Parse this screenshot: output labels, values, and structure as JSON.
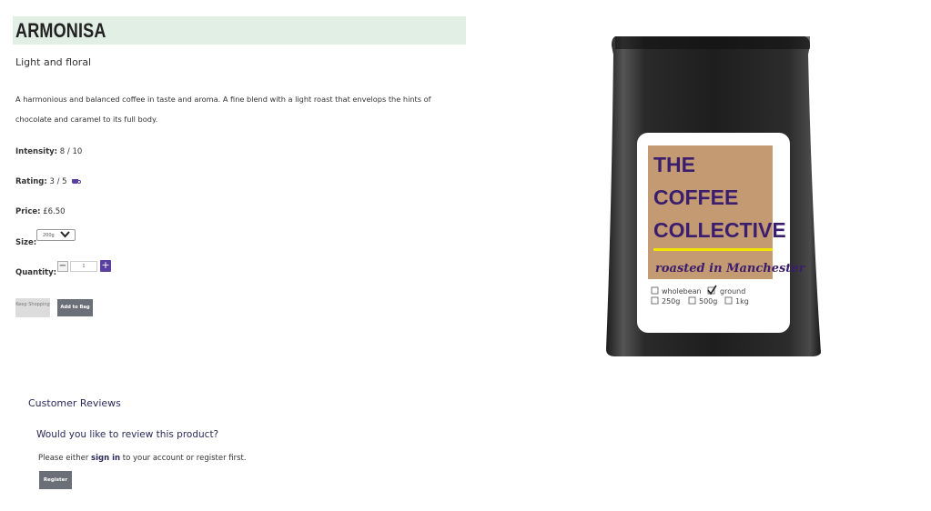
{
  "product": {
    "name": "ARMONISA",
    "subtitle": "Light and floral",
    "description": "A harmonious and balanced coffee in taste and aroma. A fine blend with a light roast that envelops the hints of chocolate and caramel to its full body.",
    "intensity_label": "Intensity:",
    "intensity_value": "8 / 10",
    "rating_label": "Rating:",
    "rating_value": "3 / 5",
    "price_label": "Price:",
    "price_value": "£6.50",
    "size_label": "Size:",
    "size_selected": "200g",
    "quantity_label": "Quantity:",
    "quantity_value": "1"
  },
  "buttons": {
    "keep_shopping": "Keep Shopping",
    "add_to_bag": "Add to Bag",
    "register": "Register",
    "minus": "−",
    "plus": "+"
  },
  "reviews": {
    "title": "Customer Reviews",
    "question": "Would you like to review this product?",
    "prompt_before": "Please either ",
    "sign_in_link": "sign in",
    "prompt_after": " to your account or register first."
  },
  "bag_label": {
    "line1": "THE",
    "line2": "COFFEE",
    "line3": "COLLECTIVE",
    "tagline": "roasted in Manchester",
    "opt_wholebean": "wholebean",
    "opt_ground": "ground",
    "opt_250": "250g",
    "opt_500": "500g",
    "opt_1kg": "1kg"
  },
  "colors": {
    "accent_purple": "#5a3ea0",
    "title_bg": "#e2efe4",
    "button_grey": "#6b7078",
    "label_tan": "#c49a72",
    "label_yellow": "#f2e600"
  },
  "icons": {
    "rating": "coffee-cup-icon",
    "select": "chevron-down-icon"
  }
}
